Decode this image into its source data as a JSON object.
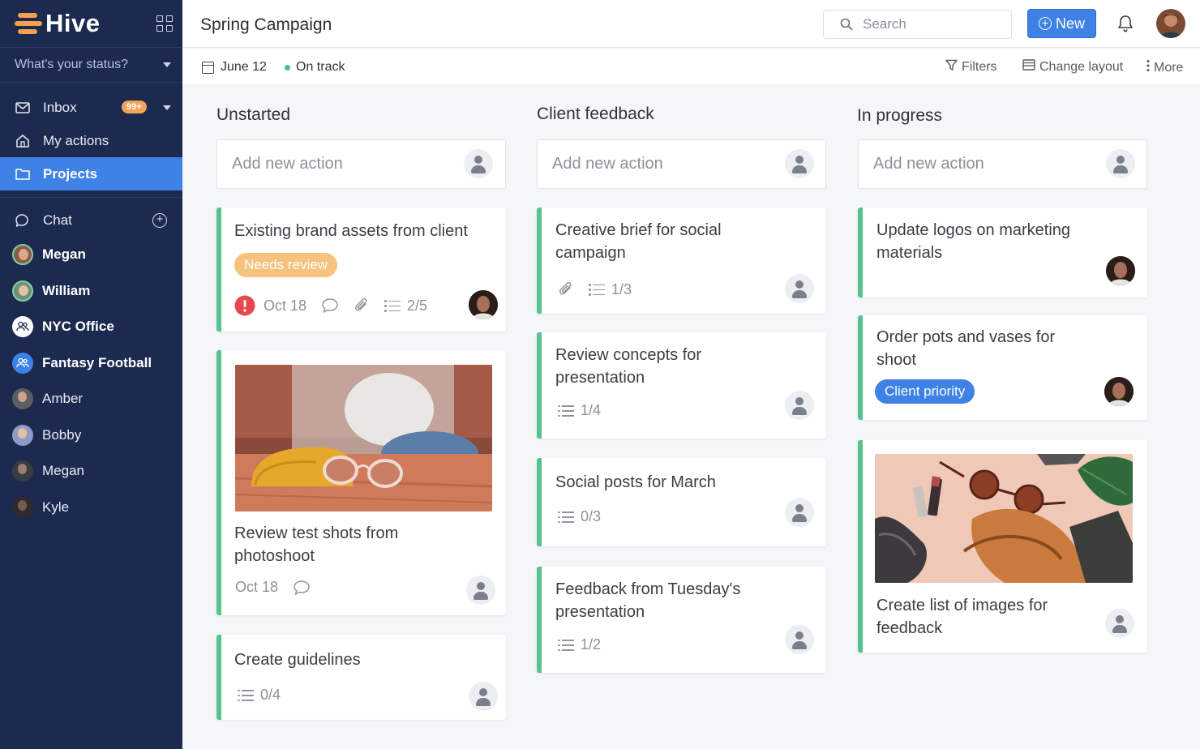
{
  "app": {
    "name": "Hive",
    "status_prompt": "What's your status?"
  },
  "sidebar": {
    "nav": [
      {
        "label": "Inbox",
        "badge": "99+"
      },
      {
        "label": "My actions"
      },
      {
        "label": "Projects"
      }
    ],
    "chat_label": "Chat",
    "people": [
      "Megan",
      "William",
      "NYC Office",
      "Fantasy Football",
      "Amber",
      "Bobby",
      "Megan",
      "Kyle"
    ]
  },
  "header": {
    "title": "Spring Campaign",
    "search_placeholder": "Search",
    "new_label": "New"
  },
  "subbar": {
    "date": "June 12",
    "status": "On track",
    "filters": "Filters",
    "change_layout": "Change layout",
    "more": "More"
  },
  "colors": {
    "sidebar": "#1c2a4f",
    "accent": "#3f82e6",
    "card_bar": "#56c28e",
    "needs_review": "#f6c27e",
    "client_priority": "#3f82e6",
    "on_track": "#4bbf8a",
    "overdue": "#e5484d"
  },
  "board": {
    "add_placeholder": "Add new action",
    "columns": [
      {
        "title": "Unstarted",
        "cards": [
          {
            "title": "Existing brand assets from client",
            "tag": "Needs review",
            "date": "Oct 18",
            "checklist": "2/5"
          },
          {
            "title": "Review test shots from photoshoot",
            "date": "Oct 18"
          },
          {
            "title": "Create guidelines",
            "checklist": "0/4"
          }
        ]
      },
      {
        "title": "Client feedback",
        "cards": [
          {
            "title": "Creative brief for social campaign",
            "checklist": "1/3"
          },
          {
            "title": "Review concepts for presentation",
            "checklist": "1/4"
          },
          {
            "title": "Social posts for March",
            "checklist": "0/3"
          },
          {
            "title": "Feedback from Tuesday's presentation",
            "checklist": "1/2"
          }
        ]
      },
      {
        "title": "In progress",
        "cards": [
          {
            "title": "Update logos on marketing materials"
          },
          {
            "title": "Order pots and vases for shoot",
            "tag": "Client priority"
          },
          {
            "title": "Create list of images for feedback"
          }
        ]
      }
    ]
  }
}
